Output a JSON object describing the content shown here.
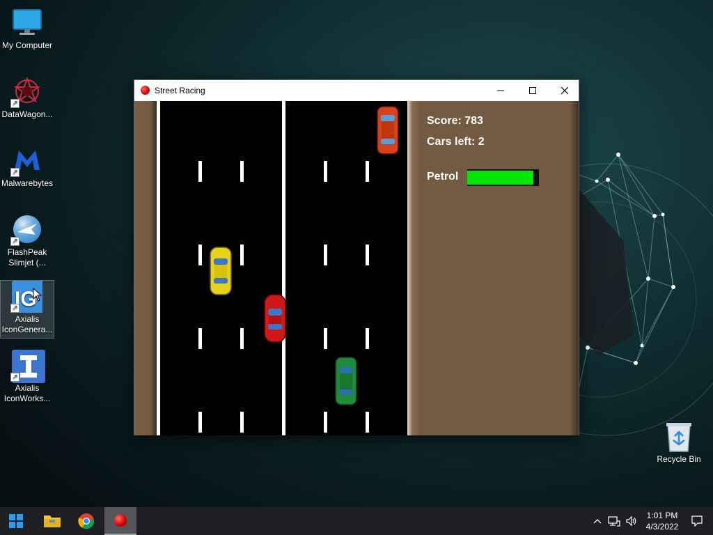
{
  "desktop": {
    "icons": [
      {
        "label": "My Computer",
        "icon": "monitor-icon"
      },
      {
        "label": "DataWagon...",
        "icon": "datawagon-icon"
      },
      {
        "label": "Malwarebytes",
        "icon": "malwarebytes-icon"
      },
      {
        "label": "FlashPeak Slimjet (...",
        "icon": "slimjet-icon"
      },
      {
        "label": "Axialis IconGenera...",
        "icon": "icongenerator-icon"
      },
      {
        "label": "Axialis IconWorks...",
        "icon": "iconworkshop-icon"
      }
    ],
    "recycle_bin": {
      "label": "Recycle Bin",
      "icon": "recycle-bin-icon"
    }
  },
  "window": {
    "title": "Street Racing",
    "controls": {
      "minimize": "minimize-icon",
      "maximize": "maximize-icon",
      "close": "close-icon"
    }
  },
  "game": {
    "score_text": "Score: 783",
    "cars_left_text": "Cars left: 2",
    "petrol_label": "Petrol",
    "petrol_level": 0.96,
    "colors": {
      "road": "#000000",
      "verge": "#735a42",
      "petrol_bar": "#00e800",
      "player_car": "#d01818"
    },
    "cars": [
      {
        "name": "player-car",
        "color": "#d01818",
        "lane": "left-road-right-lane"
      },
      {
        "name": "yellow-car",
        "color": "#e6d21a",
        "lane": "left-road-center"
      },
      {
        "name": "green-car",
        "color": "#1f8a3a",
        "lane": "right-road-center"
      },
      {
        "name": "orange-car",
        "color": "#d8411a",
        "lane": "right-road-right-lane"
      }
    ]
  },
  "taskbar": {
    "items": [
      {
        "name": "start",
        "icon": "windows-start-icon"
      },
      {
        "name": "file-explorer",
        "icon": "folder-icon"
      },
      {
        "name": "chrome",
        "icon": "chrome-icon"
      },
      {
        "name": "street-racing",
        "icon": "red-ball-icon"
      }
    ],
    "tray_icons": [
      "chevron-up-icon",
      "network-icon",
      "volume-icon"
    ],
    "time": "1:01 PM",
    "date": "4/3/2022",
    "notification_icon": "notification-icon"
  }
}
